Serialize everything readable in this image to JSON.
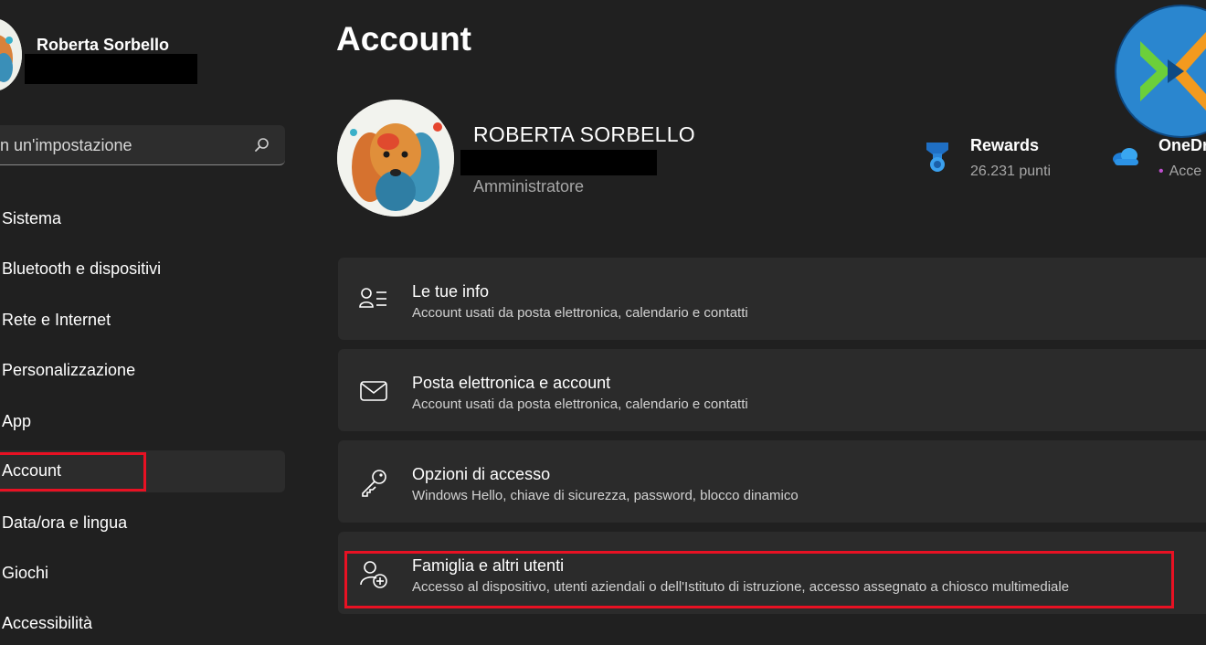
{
  "sidebar": {
    "username": "Roberta Sorbello",
    "search": {
      "placeholder": "n un'impostazione"
    },
    "items": [
      {
        "label": "Sistema"
      },
      {
        "label": "Bluetooth e dispositivi"
      },
      {
        "label": "Rete e Internet"
      },
      {
        "label": "Personalizzazione"
      },
      {
        "label": "App"
      },
      {
        "label": "Account"
      },
      {
        "label": "Data/ora e lingua"
      },
      {
        "label": "Giochi"
      },
      {
        "label": "Accessibilità"
      }
    ],
    "selected": "Account"
  },
  "header": {
    "title": "Account"
  },
  "profile": {
    "name": "ROBERTA SORBELLO",
    "role": "Amministratore"
  },
  "rewards": {
    "title": "Rewards",
    "points": "26.231 punti"
  },
  "onedrive": {
    "title": "OneDr",
    "status": "Acce"
  },
  "cards": [
    {
      "title": "Le tue info",
      "description": "Account usati da posta elettronica, calendario e contatti",
      "icon": "person-list-icon"
    },
    {
      "title": "Posta elettronica e account",
      "description": "Account usati da posta elettronica, calendario e contatti",
      "icon": "mail-icon"
    },
    {
      "title": "Opzioni di accesso",
      "description": "Windows Hello, chiave di sicurezza, password, blocco dinamico",
      "icon": "key-icon"
    },
    {
      "title": "Famiglia e altri utenti",
      "description": "Accesso al dispositivo, utenti aziendali o dell'Istituto di istruzione, accesso assegnato a chiosco multimediale",
      "icon": "person-add-icon"
    }
  ],
  "colors": {
    "background": "#202020",
    "card": "#2b2b2b",
    "highlight": "#e81123",
    "secondary_text": "#a7a7a7",
    "accent": "#4aa0e6"
  }
}
